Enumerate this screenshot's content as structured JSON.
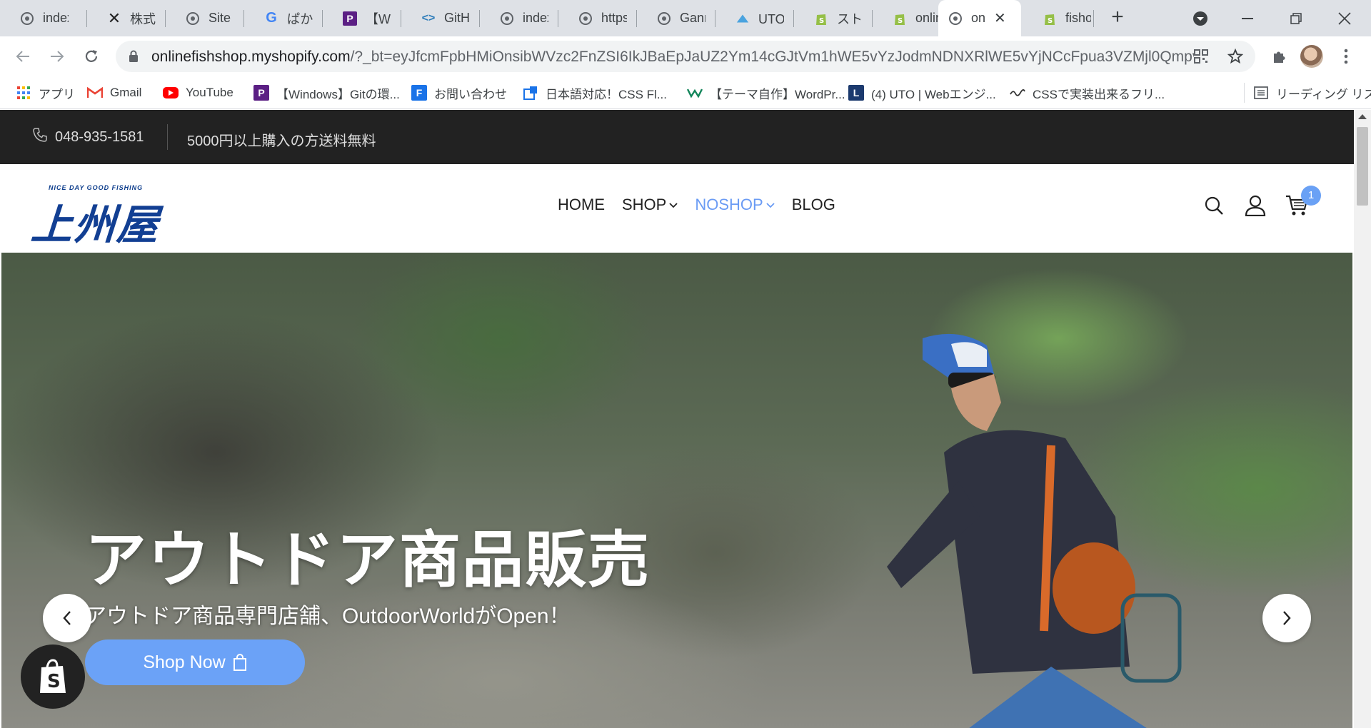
{
  "browser": {
    "tabs": [
      {
        "title": "index.h",
        "icon": "globe-icon"
      },
      {
        "title": "株式会",
        "icon": "x-logo-icon"
      },
      {
        "title": "Site no",
        "icon": "globe-icon"
      },
      {
        "title": "ぱかま",
        "icon": "google-icon"
      },
      {
        "title": "【Wind",
        "icon": "purple-p-icon"
      },
      {
        "title": "GitHu",
        "icon": "code-icon"
      },
      {
        "title": "index.",
        "icon": "globe-icon"
      },
      {
        "title": "https:",
        "icon": "globe-icon"
      },
      {
        "title": "Ganm",
        "icon": "globe-icon"
      },
      {
        "title": "UTOさ",
        "icon": "cloud-icon"
      },
      {
        "title": "ストア管",
        "icon": "shopify-icon"
      },
      {
        "title": "online",
        "icon": "shopify-icon"
      },
      {
        "title": "on",
        "icon": "globe-icon",
        "active": true
      },
      {
        "title": "fishou",
        "icon": "shopify-icon"
      }
    ],
    "new_tab": "+",
    "url_host": "onlinefishshop.myshopify.com",
    "url_rest": "/?_bt=eyJfcmFpbHMiOnsibWVzc2FnZSI6IkJBaEpJaUZ2Ym14cGJtVm1hWE5vYzJodmNDNXRlWE5vYjNCcFpua3VZMjl0QmpvR...",
    "bookmarks": [
      {
        "label": "アプリ",
        "icon": "apps-grid-icon"
      },
      {
        "label": "Gmail",
        "icon": "gmail-icon"
      },
      {
        "label": "YouTube",
        "icon": "youtube-icon"
      },
      {
        "label": "【Windows】Gitの環...",
        "icon": "purple-p-icon"
      },
      {
        "label": "お問い合わせ",
        "icon": "f-icon"
      },
      {
        "label": "日本語対応！CSS Fl...",
        "icon": "external-icon"
      },
      {
        "label": "【テーマ自作】WordPr...",
        "icon": "w-icon"
      },
      {
        "label": "(4) UTO | Webエンジ...",
        "icon": "l-icon"
      },
      {
        "label": "CSSで実装出来るフリ...",
        "icon": "swirl-icon"
      }
    ],
    "reading_list": "リーディング リスト"
  },
  "site": {
    "topbar": {
      "phone": "048-935-1581",
      "shipping": "5000円以上購入の方送料無料"
    },
    "logo": {
      "tagline": "NICE DAY GOOD FISHING",
      "mark": "上州屋"
    },
    "menu": [
      {
        "label": "HOME"
      },
      {
        "label": "SHOP",
        "dropdown": true
      },
      {
        "label": "NOSHOP",
        "dropdown": true,
        "active": true
      },
      {
        "label": "BLOG"
      }
    ],
    "cart_count": "1",
    "hero": {
      "title": "アウトドア商品販売",
      "subtitle": "アウトドア商品専門店舗、OutdoorWorldがOpen！",
      "cta": "Shop Now"
    },
    "colors": {
      "accent": "#6ba2f7",
      "topbar_bg": "#222222",
      "logo": "#123f93"
    }
  }
}
